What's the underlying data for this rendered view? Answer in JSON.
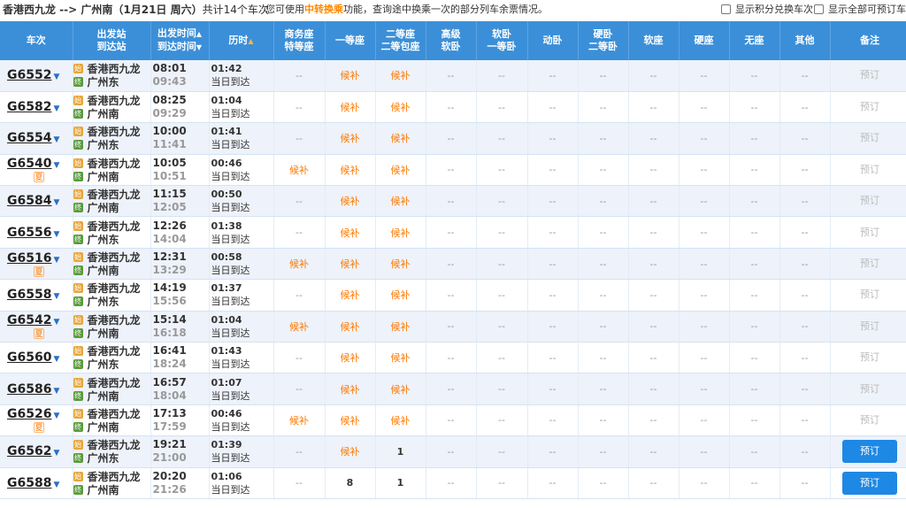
{
  "topbar": {
    "route": "香港西九龙 --> 广州南",
    "date": "（1月21日 周六）",
    "count": "共计14个车次",
    "tip_pre": "您可使用",
    "tip_hl": "中转换乘",
    "tip_post": "功能，查询途中换乘一次的部分列车余票情况。",
    "chk1_label": "显示积分兑换车次",
    "chk2_label": "显示全部可预订车次"
  },
  "headers": {
    "train": "车次",
    "station1": "出发站",
    "station2": "到达站",
    "time1": "出发时间",
    "time2": "到达时间",
    "duration": "历时",
    "biz1": "商务座",
    "biz2": "特等座",
    "first": "一等座",
    "second1": "二等座",
    "second2": "二等包座",
    "gjrw1": "高级",
    "gjrw2": "软卧",
    "rw1": "软卧",
    "rw2": "一等卧",
    "dw": "动卧",
    "yw1": "硬卧",
    "yw2": "二等卧",
    "rz": "软座",
    "yz": "硬座",
    "wz": "无座",
    "qt": "其他",
    "remark": "备注"
  },
  "labels": {
    "houbu": "候补",
    "none": "--",
    "book": "预订",
    "same_day": "当日到达",
    "summer": "夏",
    "start_badge": "始",
    "pass_badge": "终"
  },
  "colors": {
    "header_bg": "#3b8fd8",
    "houbu": "#ff7a00",
    "book_active": "#1e88e5"
  },
  "trains": [
    {
      "no": "G6552",
      "xia": false,
      "from": "香港西九龙",
      "to": "广州东",
      "dep": "08:01",
      "arr": "09:43",
      "dur": "01:42",
      "biz": "--",
      "first": "候补",
      "second": "候补",
      "active": false
    },
    {
      "no": "G6582",
      "xia": false,
      "from": "香港西九龙",
      "to": "广州南",
      "dep": "08:25",
      "arr": "09:29",
      "dur": "01:04",
      "biz": "--",
      "first": "候补",
      "second": "候补",
      "active": false
    },
    {
      "no": "G6554",
      "xia": false,
      "from": "香港西九龙",
      "to": "广州东",
      "dep": "10:00",
      "arr": "11:41",
      "dur": "01:41",
      "biz": "--",
      "first": "候补",
      "second": "候补",
      "active": false
    },
    {
      "no": "G6540",
      "xia": true,
      "from": "香港西九龙",
      "to": "广州南",
      "dep": "10:05",
      "arr": "10:51",
      "dur": "00:46",
      "biz": "候补",
      "first": "候补",
      "second": "候补",
      "active": false
    },
    {
      "no": "G6584",
      "xia": false,
      "from": "香港西九龙",
      "to": "广州南",
      "dep": "11:15",
      "arr": "12:05",
      "dur": "00:50",
      "biz": "--",
      "first": "候补",
      "second": "候补",
      "active": false
    },
    {
      "no": "G6556",
      "xia": false,
      "from": "香港西九龙",
      "to": "广州东",
      "dep": "12:26",
      "arr": "14:04",
      "dur": "01:38",
      "biz": "--",
      "first": "候补",
      "second": "候补",
      "active": false
    },
    {
      "no": "G6516",
      "xia": true,
      "from": "香港西九龙",
      "to": "广州南",
      "dep": "12:31",
      "arr": "13:29",
      "dur": "00:58",
      "biz": "候补",
      "first": "候补",
      "second": "候补",
      "active": false
    },
    {
      "no": "G6558",
      "xia": false,
      "from": "香港西九龙",
      "to": "广州东",
      "dep": "14:19",
      "arr": "15:56",
      "dur": "01:37",
      "biz": "--",
      "first": "候补",
      "second": "候补",
      "active": false
    },
    {
      "no": "G6542",
      "xia": true,
      "from": "香港西九龙",
      "to": "广州南",
      "dep": "15:14",
      "arr": "16:18",
      "dur": "01:04",
      "biz": "候补",
      "first": "候补",
      "second": "候补",
      "active": false
    },
    {
      "no": "G6560",
      "xia": false,
      "from": "香港西九龙",
      "to": "广州东",
      "dep": "16:41",
      "arr": "18:24",
      "dur": "01:43",
      "biz": "--",
      "first": "候补",
      "second": "候补",
      "active": false
    },
    {
      "no": "G6586",
      "xia": false,
      "from": "香港西九龙",
      "to": "广州南",
      "dep": "16:57",
      "arr": "18:04",
      "dur": "01:07",
      "biz": "--",
      "first": "候补",
      "second": "候补",
      "active": false
    },
    {
      "no": "G6526",
      "xia": true,
      "from": "香港西九龙",
      "to": "广州南",
      "dep": "17:13",
      "arr": "17:59",
      "dur": "00:46",
      "biz": "候补",
      "first": "候补",
      "second": "候补",
      "active": false
    },
    {
      "no": "G6562",
      "xia": false,
      "from": "香港西九龙",
      "to": "广州东",
      "dep": "19:21",
      "arr": "21:00",
      "dur": "01:39",
      "biz": "--",
      "first": "候补",
      "second": "1",
      "active": true
    },
    {
      "no": "G6588",
      "xia": false,
      "from": "香港西九龙",
      "to": "广州南",
      "dep": "20:20",
      "arr": "21:26",
      "dur": "01:06",
      "biz": "--",
      "first": "8",
      "second": "1",
      "active": true
    }
  ]
}
